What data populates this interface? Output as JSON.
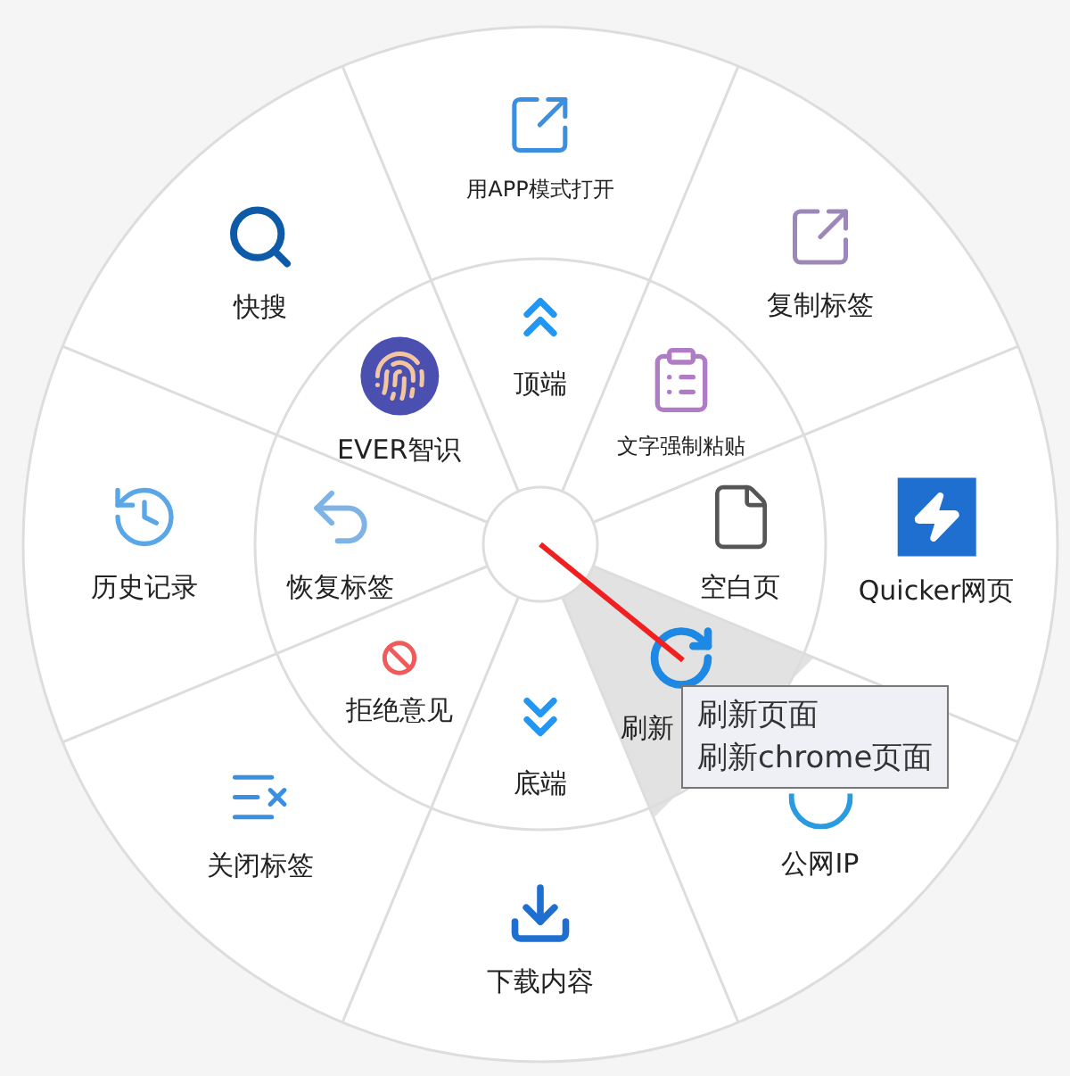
{
  "outer_ring": [
    {
      "label": "用APP模式打开"
    },
    {
      "label": "复制标签"
    },
    {
      "label": "Quicker网页"
    },
    {
      "label": "公网IP"
    },
    {
      "label": "下载内容"
    },
    {
      "label": "关闭标签"
    },
    {
      "label": "历史记录"
    },
    {
      "label": "快搜"
    }
  ],
  "inner_ring": [
    {
      "label": "顶端",
      "selected": false
    },
    {
      "label": "文字强制粘贴",
      "selected": false
    },
    {
      "label": "空白页",
      "selected": false
    },
    {
      "label": "刷新",
      "selected": true
    },
    {
      "label": "底端",
      "selected": false
    },
    {
      "label": "拒绝意见",
      "selected": false
    },
    {
      "label": "恢复标签",
      "selected": false
    },
    {
      "label": "EVER智识",
      "selected": false
    }
  ],
  "tooltip": {
    "lines": [
      "刷新页面",
      "刷新chrome页面"
    ]
  }
}
